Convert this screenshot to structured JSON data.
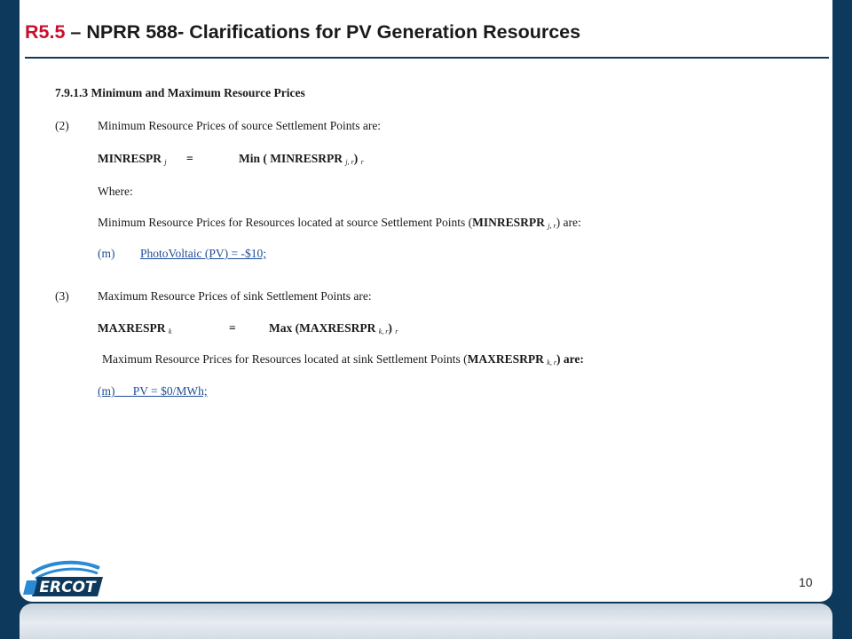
{
  "header": {
    "code": "R5.5",
    "title_rest": " – NPRR 588- Clarifications for PV Generation Resources"
  },
  "section": {
    "heading": "7.9.1.3 Minimum and Maximum Resource Prices",
    "p2": {
      "num": "(2)",
      "text": "Minimum Resource Prices of source Settlement Points are:",
      "formula_lhs": "MINRESPR",
      "formula_lhs_sub": "j",
      "formula_eq": "=",
      "formula_rhs": "Min ( MINRESRPR",
      "formula_rhs_sub": "j, r",
      "formula_close": ")",
      "formula_close_sub": "r",
      "where": "Where:",
      "desc_pre": "Minimum Resource Prices for Resources located at source Settlement Points (",
      "desc_bold": "MINRESRPR",
      "desc_sub": "j, r",
      "desc_post": ") are:",
      "item_label": "(m)",
      "item_text": "PhotoVoltaic (PV) = -$10;"
    },
    "p3": {
      "num": "(3)",
      "text": "Maximum Resource Prices of sink Settlement Points are:",
      "formula_lhs": "MAXRESPR",
      "formula_lhs_sub": "k",
      "formula_eq": "=",
      "formula_rhs": "Max (MAXRESRPR",
      "formula_rhs_sub": "k, r",
      "formula_close": ")",
      "formula_close_sub": "r",
      "desc_pre": "Maximum Resource Prices for Resources located at sink Settlement Points (",
      "desc_bold": "MAXRESRPR",
      "desc_sub": "k, r",
      "desc_post": ") are:",
      "item_label": "(m)",
      "item_text": "PV = $0/MWh;"
    }
  },
  "footer": {
    "page_number": "10",
    "logo_text": "ERCOT"
  },
  "colors": {
    "frame": "#0d3a5c",
    "accent_red": "#c8102e",
    "link_blue": "#1f4e99"
  }
}
